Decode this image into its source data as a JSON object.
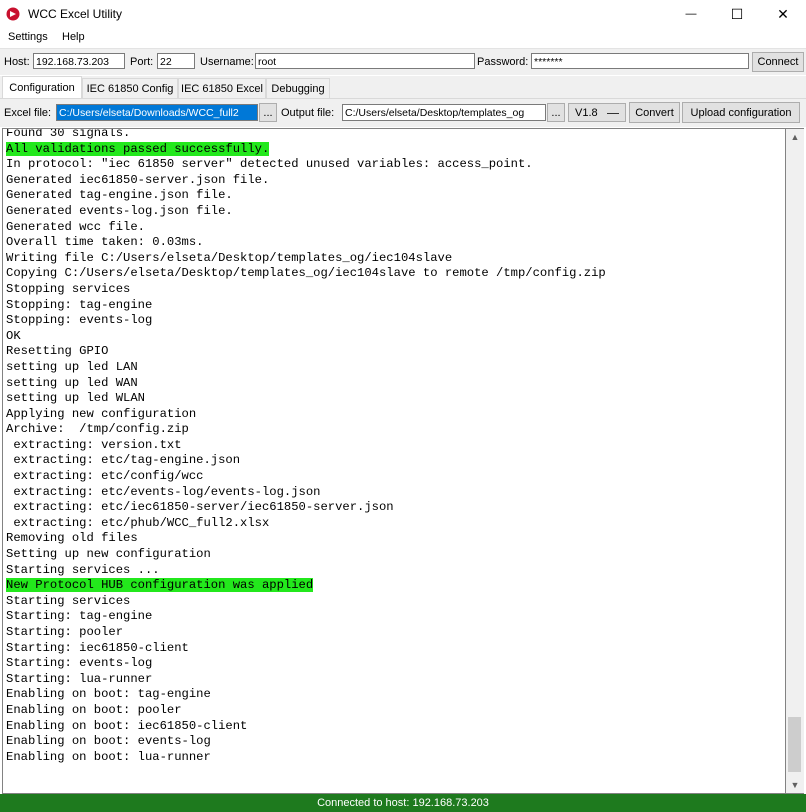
{
  "window": {
    "title": "WCC Excel Utility",
    "minimize_glyph": "—",
    "maximize_glyph": "☐",
    "close_glyph": "✕"
  },
  "menu": {
    "items": [
      "Settings",
      "Help"
    ]
  },
  "connection": {
    "host_label": "Host:",
    "host_value": "192.168.73.203",
    "port_label": "Port:",
    "port_value": "22",
    "username_label": "Username:",
    "username_value": "root",
    "password_label": "Password:",
    "password_value": "*******",
    "connect_label": "Connect"
  },
  "tabs": [
    "Configuration",
    "IEC 61850 Config",
    "IEC 61850 Excel",
    "Debugging"
  ],
  "toolbar": {
    "excel_label": "Excel file:",
    "excel_value": "C:/Users/elseta/Downloads/WCC_full2",
    "browse_label": "...",
    "output_label": "Output file:",
    "output_value": "C:/Users/elseta/Desktop/templates_og",
    "browse2_label": "...",
    "version_value": "V1.8",
    "convert_label": "Convert",
    "upload_label": "Upload configuration"
  },
  "console": {
    "lines": [
      {
        "text": "Found 30 signals.",
        "hl": false
      },
      {
        "text": "All validations passed successfully.",
        "hl": true
      },
      {
        "text": "In protocol: \"iec 61850 server\" detected unused variables: access_point.",
        "hl": false
      },
      {
        "text": "Generated iec61850-server.json file.",
        "hl": false
      },
      {
        "text": "Generated tag-engine.json file.",
        "hl": false
      },
      {
        "text": "Generated events-log.json file.",
        "hl": false
      },
      {
        "text": "Generated wcc file.",
        "hl": false
      },
      {
        "text": "Overall time taken: 0.03ms.",
        "hl": false
      },
      {
        "text": "Writing file C:/Users/elseta/Desktop/templates_og/iec104slave",
        "hl": false
      },
      {
        "text": "Copying C:/Users/elseta/Desktop/templates_og/iec104slave to remote /tmp/config.zip",
        "hl": false
      },
      {
        "text": "Stopping services",
        "hl": false
      },
      {
        "text": "Stopping: tag-engine",
        "hl": false
      },
      {
        "text": "Stopping: events-log",
        "hl": false
      },
      {
        "text": "OK",
        "hl": false
      },
      {
        "text": "Resetting GPIO",
        "hl": false
      },
      {
        "text": "setting up led LAN",
        "hl": false
      },
      {
        "text": "setting up led WAN",
        "hl": false
      },
      {
        "text": "setting up led WLAN",
        "hl": false
      },
      {
        "text": "Applying new configuration",
        "hl": false
      },
      {
        "text": "Archive:  /tmp/config.zip",
        "hl": false
      },
      {
        "text": " extracting: version.txt",
        "hl": false
      },
      {
        "text": " extracting: etc/tag-engine.json",
        "hl": false
      },
      {
        "text": " extracting: etc/config/wcc",
        "hl": false
      },
      {
        "text": " extracting: etc/events-log/events-log.json",
        "hl": false
      },
      {
        "text": " extracting: etc/iec61850-server/iec61850-server.json",
        "hl": false
      },
      {
        "text": " extracting: etc/phub/WCC_full2.xlsx",
        "hl": false
      },
      {
        "text": "Removing old files",
        "hl": false
      },
      {
        "text": "Setting up new configuration",
        "hl": false
      },
      {
        "text": "Starting services ...",
        "hl": false
      },
      {
        "text": "New Protocol HUB configuration was applied",
        "hl": true
      },
      {
        "text": "Starting services",
        "hl": false
      },
      {
        "text": "Starting: tag-engine",
        "hl": false
      },
      {
        "text": "Starting: pooler",
        "hl": false
      },
      {
        "text": "Starting: iec61850-client",
        "hl": false
      },
      {
        "text": "Starting: events-log",
        "hl": false
      },
      {
        "text": "Starting: lua-runner",
        "hl": false
      },
      {
        "text": "Enabling on boot: tag-engine",
        "hl": false
      },
      {
        "text": "Enabling on boot: pooler",
        "hl": false
      },
      {
        "text": "Enabling on boot: iec61850-client",
        "hl": false
      },
      {
        "text": "Enabling on boot: events-log",
        "hl": false
      },
      {
        "text": "Enabling on boot: lua-runner",
        "hl": false
      }
    ],
    "highlight_color": "#23e81c"
  },
  "status": {
    "text": "Connected to host: 192.168.73.203",
    "color": "#1e7a1e"
  }
}
